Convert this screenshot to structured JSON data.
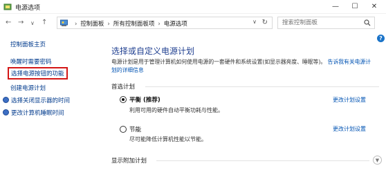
{
  "window": {
    "title": "电源选项",
    "minimize": "—",
    "maximize": "☐",
    "close": "✕"
  },
  "nav": {
    "back": "←",
    "forward": "→",
    "dropdown": "∨",
    "up": "↑"
  },
  "address": {
    "crumbs": [
      "控制面板",
      "所有控制面板项",
      "电源选项"
    ],
    "separator": "›",
    "dropdown": "∨",
    "refresh": "↻"
  },
  "search": {
    "placeholder": "搜索控制面板"
  },
  "help_label": "?",
  "sidebar": {
    "items": [
      {
        "label": "控制面板主页"
      },
      {
        "label": "唤醒时需要密码"
      },
      {
        "label": "选择电源按钮的功能"
      },
      {
        "label": "创建电源计划"
      },
      {
        "label": "选择关闭显示器的时间"
      },
      {
        "label": "更改计算机睡眠时间"
      }
    ]
  },
  "main": {
    "heading": "选择或自定义电源计划",
    "description": "电源计划是用于管理计算机如何使用电源的一套硬件和系统设置(如显示器亮度、睡眠等)。",
    "description_link": "告诉我有关电源计划的详细信息",
    "preferred_label": "首选计划",
    "plans": [
      {
        "name": "平衡 (推荐)",
        "desc": "利用可用的硬件自动平衡功耗与性能。",
        "link": "更改计划设置",
        "selected": true
      },
      {
        "name": "节能",
        "desc": "尽可能降低计算机性能以节能。",
        "link": "更改计划设置",
        "selected": false
      }
    ],
    "additional_label": "显示附加计划"
  },
  "colors": {
    "link": "#0053b3",
    "heading": "#1f3f90",
    "highlight_box": "#d31515"
  }
}
